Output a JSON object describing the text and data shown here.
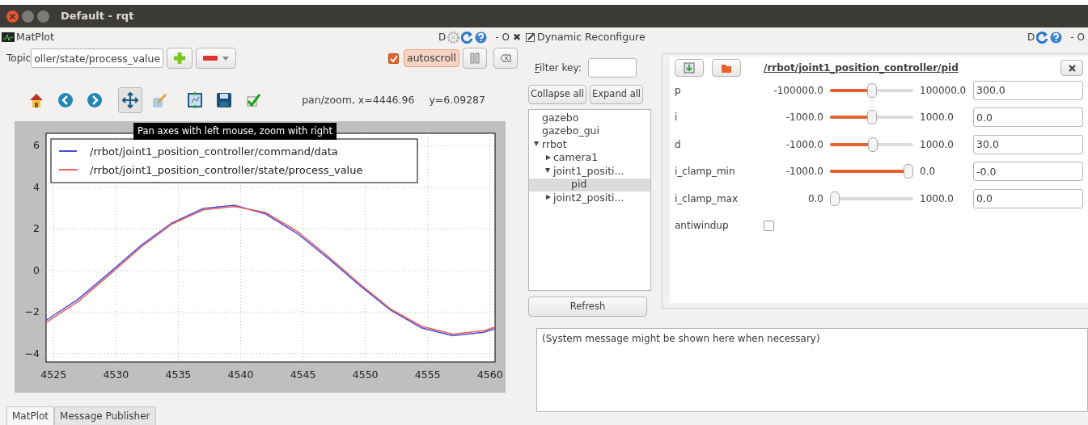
{
  "window": {
    "title": "Default - rqt"
  },
  "matplot": {
    "title": "MatPlot",
    "header_letter": "D",
    "header_controls": [
      "-",
      "O",
      "✖"
    ],
    "topic_label": "Topic",
    "topic_value": "oller/state/process_value",
    "autoscroll": {
      "label": "autoscroll",
      "checked": true
    },
    "toolbar": [
      {
        "kind": "home",
        "selected": false
      },
      {
        "kind": "back",
        "selected": false
      },
      {
        "kind": "forward",
        "selected": false
      },
      {
        "kind": "pan",
        "selected": true
      },
      {
        "kind": "zoom",
        "selected": false
      },
      {
        "kind": "subplots",
        "selected": false
      },
      {
        "kind": "save",
        "selected": false
      },
      {
        "kind": "check",
        "selected": false
      }
    ],
    "coordinates": [
      "pan/zoom, x=4446.96",
      "y=6.09287"
    ],
    "tooltip": "Pan axes with left mouse, zoom with right",
    "chart_data": {
      "type": "line",
      "x": [
        4524.4,
        4527,
        4529.5,
        4532,
        4534.5,
        4537,
        4539.5,
        4542,
        4544.5,
        4547,
        4549.5,
        4552,
        4554.5,
        4557,
        4559.5,
        4560.4
      ],
      "series": [
        {
          "name": "/rrbot/joint1_position_controller/command/data",
          "color": "#4b4bd6",
          "values": [
            -2.4,
            -1.36,
            -0.1,
            1.2,
            2.29,
            2.98,
            3.14,
            2.72,
            1.8,
            0.6,
            -0.69,
            -1.9,
            -2.76,
            -3.14,
            -2.97,
            -2.8
          ]
        },
        {
          "name": "/rrbot/joint1_position_controller/state/process_value",
          "color": "#e8605a",
          "values": [
            -2.5,
            -1.48,
            -0.2,
            1.12,
            2.24,
            2.92,
            3.08,
            2.79,
            1.9,
            0.69,
            -0.62,
            -1.84,
            -2.68,
            -3.06,
            -2.89,
            -2.72
          ]
        }
      ],
      "grid": true,
      "legend": true,
      "xlim": [
        4524.4,
        4560.4
      ],
      "ylim": [
        -4.4,
        6.6
      ],
      "xticks": [
        4525,
        4530,
        4535,
        4540,
        4545,
        4550,
        4555,
        4560
      ],
      "yticks": [
        {
          "value": -4,
          "label": "−4"
        },
        {
          "value": -2,
          "label": "−2"
        },
        0,
        2,
        4,
        6
      ]
    }
  },
  "bottom_tabs": [
    {
      "label": "MatPlot",
      "selected": true
    },
    {
      "label": "Message Publisher",
      "selected": false
    }
  ],
  "reconfigure": {
    "title": "Dynamic Reconfigure",
    "header_letter": "D",
    "header_controls": [
      "-",
      "O"
    ],
    "filter_label": "Filter key:",
    "collapse_all": "Collapse all",
    "expand_all": "Expand all",
    "tree": [
      {
        "label": "gazebo",
        "selected": false
      },
      {
        "label": "gazebo_gui",
        "selected": false
      },
      {
        "label": "rrbot",
        "expanded": true,
        "selected": false,
        "children": [
          {
            "label": "camera1",
            "expanded": false,
            "selected": false
          },
          {
            "label": "joint1_positi...",
            "expanded": true,
            "selected": false,
            "children": [
              {
                "label": "pid",
                "selected": true
              }
            ]
          },
          {
            "label": "joint2_positi...",
            "expanded": false,
            "selected": false
          }
        ]
      }
    ],
    "refresh": "Refresh",
    "node_path": "/rrbot/joint1_position_controller/pid",
    "params": [
      {
        "kind": "slider",
        "name": "p",
        "min": "-100000.0",
        "max": "100000.0",
        "value": "300.0",
        "level": 0.5015
      },
      {
        "kind": "slider",
        "name": "i",
        "min": "-1000.0",
        "max": "1000.0",
        "value": "0.0",
        "level": 0.5
      },
      {
        "kind": "slider",
        "name": "d",
        "min": "-1000.0",
        "max": "1000.0",
        "value": "30.0",
        "level": 0.515
      },
      {
        "kind": "slider",
        "name": "i_clamp_min",
        "min": "-1000.0",
        "max": "0.0",
        "value": "-0.0",
        "level": 1
      },
      {
        "kind": "slider",
        "name": "i_clamp_max",
        "min": "0.0",
        "max": "1000.0",
        "value": "0.0",
        "level": 0
      },
      {
        "kind": "checkbox",
        "name": "antiwindup",
        "checked": false
      }
    ],
    "system_message": "(System message might be shown here when necessary)"
  }
}
